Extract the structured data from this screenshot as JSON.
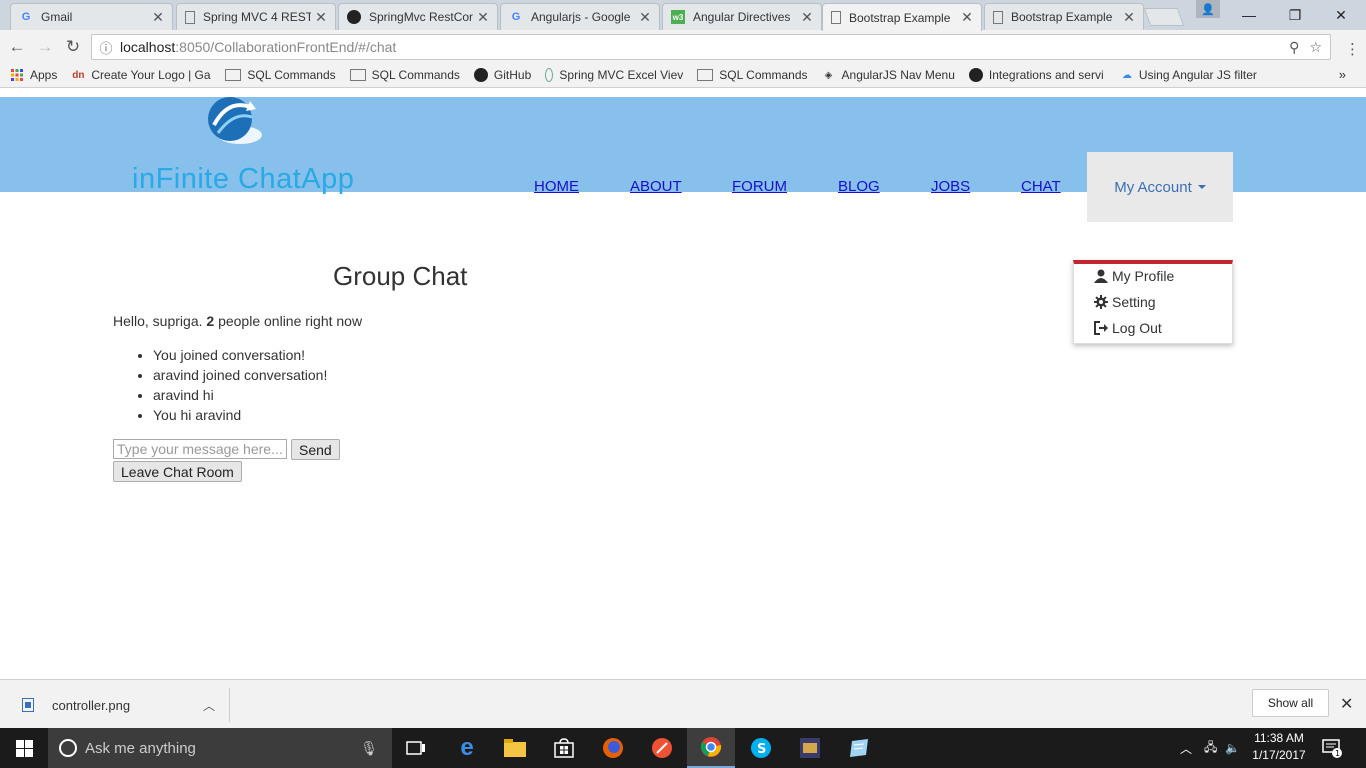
{
  "browser": {
    "tabs": [
      {
        "title": "Gmail",
        "icon": "google-g-icon"
      },
      {
        "title": "Spring MVC 4 REST",
        "icon": "page-icon"
      },
      {
        "title": "SpringMvc RestCor",
        "icon": "github-icon"
      },
      {
        "title": "Angularjs - Google",
        "icon": "google-g-icon"
      },
      {
        "title": "Angular Directives",
        "icon": "w3-icon"
      },
      {
        "title": "Bootstrap Example",
        "icon": "page-icon",
        "active": true
      },
      {
        "title": "Bootstrap Example",
        "icon": "page-icon"
      }
    ],
    "url_host": "localhost",
    "url_path": ":8050/CollaborationFrontEnd/#/chat",
    "bookmarks": [
      {
        "label": "Apps",
        "icon": "apps-grid-icon"
      },
      {
        "label": "Create Your Logo | Ga",
        "icon": "dm-icon"
      },
      {
        "label": "SQL Commands",
        "icon": "page-icon"
      },
      {
        "label": "SQL Commands",
        "icon": "page-icon"
      },
      {
        "label": "GitHub",
        "icon": "github-icon"
      },
      {
        "label": "Spring MVC Excel Viev",
        "icon": "spring-icon"
      },
      {
        "label": "SQL Commands",
        "icon": "page-icon"
      },
      {
        "label": "AngularJS Nav Menu",
        "icon": "diamond-icon"
      },
      {
        "label": "Integrations and servi",
        "icon": "github-icon"
      },
      {
        "label": "Using Angular JS filter",
        "icon": "cloud-icon"
      }
    ],
    "more_bookmarks": "»"
  },
  "site": {
    "logo_text": "inFinite ChatApp",
    "nav": [
      {
        "label": "HOME"
      },
      {
        "label": "ABOUT"
      },
      {
        "label": "FORUM"
      },
      {
        "label": "BLOG"
      },
      {
        "label": "JOBS"
      },
      {
        "label": "CHAT"
      }
    ],
    "account_label": "My Account",
    "account_menu": [
      {
        "label": "My Profile",
        "icon": "user-icon"
      },
      {
        "label": "Setting",
        "icon": "gear-icon"
      },
      {
        "label": "Log Out",
        "icon": "logout-icon"
      }
    ],
    "colors": {
      "header": "#87c0ea",
      "accent": "#c1272d",
      "link": "#1a0dcc"
    }
  },
  "chat": {
    "title": "Group Chat",
    "hello_prefix": "Hello, supriga. ",
    "online_count": "2",
    "hello_suffix": " people online right now",
    "messages": [
      "You joined conversation!",
      "aravind joined conversation!",
      "aravind hi",
      "You hi aravind"
    ],
    "input_placeholder": "Type your message here...",
    "send_label": "Send",
    "leave_label": "Leave Chat Room"
  },
  "downloads": {
    "file_name": "controller.png",
    "show_all": "Show all"
  },
  "taskbar": {
    "search_placeholder": "Ask me anything",
    "time": "11:38 AM",
    "date": "1/17/2017",
    "notification_count": "1"
  }
}
